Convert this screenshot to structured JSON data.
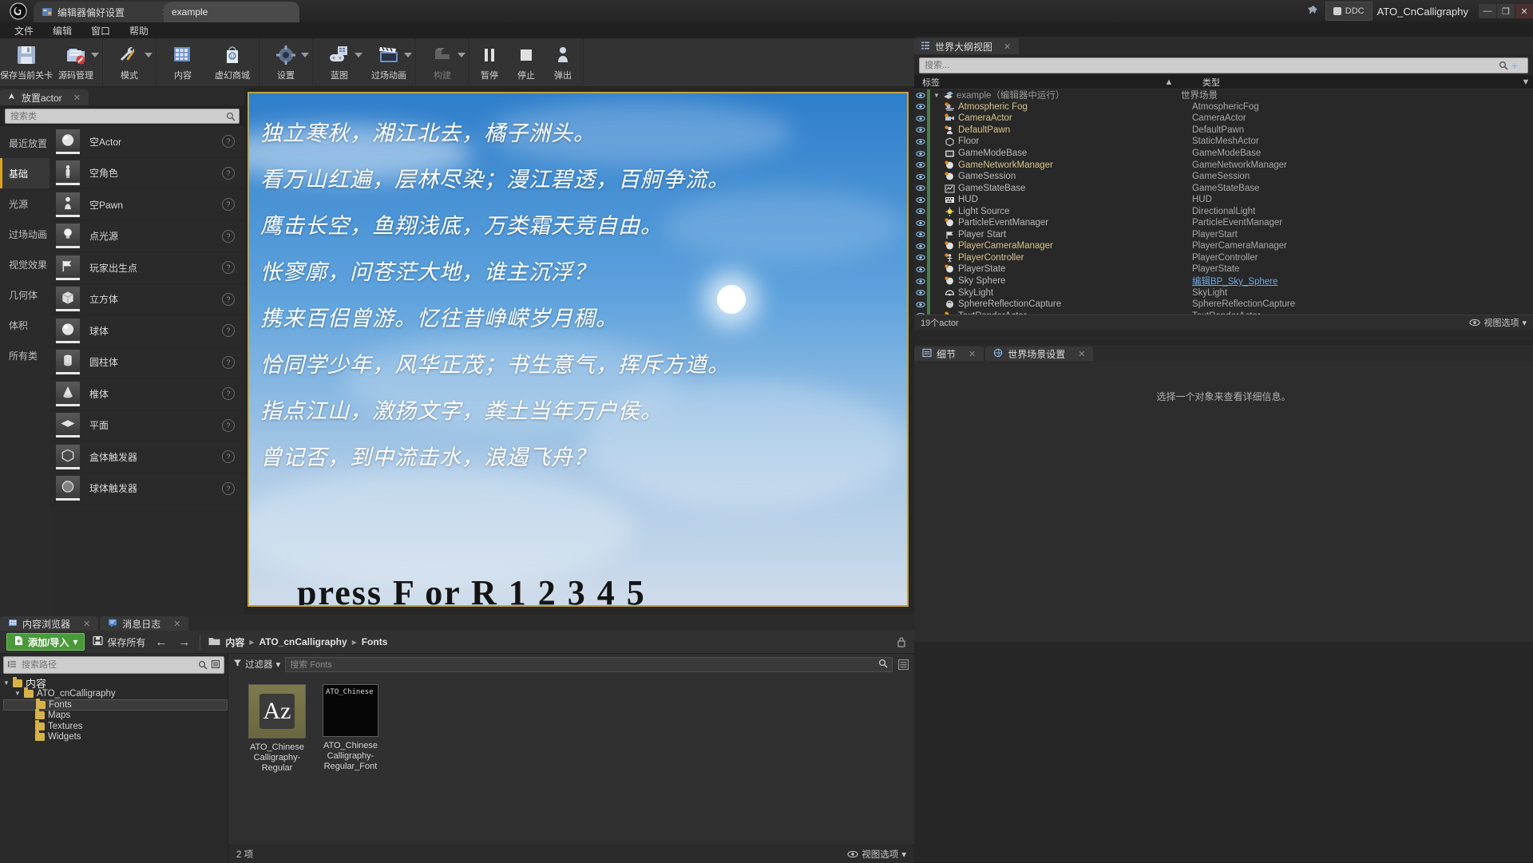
{
  "titlebar": {
    "logo_icon": "unreal-engine-logo",
    "tabs": [
      {
        "label": "编辑器偏好设置",
        "icon": "editor-prefs-icon",
        "active": false
      },
      {
        "label": "example",
        "icon": "",
        "active": true
      }
    ],
    "pin_icon": "pin-icon",
    "ddc_label": "DDC",
    "project_name": "ATO_CnCalligraphy",
    "minimize": "—",
    "maximize": "❐",
    "close": "✕"
  },
  "menubar": {
    "items": [
      "文件",
      "编辑",
      "窗口",
      "帮助"
    ]
  },
  "toolbar": {
    "groups": [
      {
        "buttons": [
          {
            "label": "保存当前关卡",
            "icon": "save-level-icon",
            "caret": false
          },
          {
            "label": "源码管理",
            "icon": "source-control-icon",
            "caret": true
          }
        ]
      },
      {
        "buttons": [
          {
            "label": "模式",
            "icon": "modes-wrench-icon",
            "caret": true
          }
        ]
      },
      {
        "buttons": [
          {
            "label": "内容",
            "icon": "content-grid-icon",
            "caret": false
          },
          {
            "label": "虚幻商城",
            "icon": "marketplace-bag-icon",
            "caret": false
          }
        ]
      },
      {
        "buttons": [
          {
            "label": "设置",
            "icon": "settings-gear-icon",
            "caret": true
          }
        ]
      },
      {
        "buttons": [
          {
            "label": "蓝图",
            "icon": "blueprint-gamepad-icon",
            "caret": true
          },
          {
            "label": "过场动画",
            "icon": "cinematics-clapper-icon",
            "caret": true
          }
        ]
      },
      {
        "buttons": [
          {
            "label": "构建",
            "icon": "build-icon",
            "caret": true,
            "disabled": true
          }
        ]
      },
      {
        "buttons": [
          {
            "label": "暂停",
            "icon": "pause-icon",
            "caret": false
          },
          {
            "label": "停止",
            "icon": "stop-icon",
            "caret": false
          },
          {
            "label": "弹出",
            "icon": "eject-icon",
            "caret": false
          }
        ]
      }
    ]
  },
  "place_panel": {
    "tab_label": "放置actor",
    "tab_icon": "place-actor-icon",
    "close_icon": "close-icon",
    "search_placeholder": "搜索类",
    "search_value": "",
    "search_icon": "search-icon",
    "categories": [
      {
        "label": "最近放置",
        "selected": false
      },
      {
        "label": "基础",
        "selected": true
      },
      {
        "label": "光源",
        "selected": false
      },
      {
        "label": "过场动画",
        "selected": false
      },
      {
        "label": "视觉效果",
        "selected": false
      },
      {
        "label": "几何体",
        "selected": false
      },
      {
        "label": "体积",
        "selected": false
      },
      {
        "label": "所有类",
        "selected": false
      }
    ],
    "items": [
      {
        "label": "空Actor",
        "icon": "sphere-thumb"
      },
      {
        "label": "空角色",
        "icon": "character-thumb"
      },
      {
        "label": "空Pawn",
        "icon": "pawn-thumb"
      },
      {
        "label": "点光源",
        "icon": "pointlight-thumb"
      },
      {
        "label": "玩家出生点",
        "icon": "playerstart-thumb"
      },
      {
        "label": "立方体",
        "icon": "cube-thumb"
      },
      {
        "label": "球体",
        "icon": "sphere-thumb"
      },
      {
        "label": "圆柱体",
        "icon": "cylinder-thumb"
      },
      {
        "label": "椎体",
        "icon": "cone-thumb"
      },
      {
        "label": "平面",
        "icon": "plane-thumb"
      },
      {
        "label": "盒体触发器",
        "icon": "boxtrigger-thumb"
      },
      {
        "label": "球体触发器",
        "icon": "spheretrigger-thumb"
      }
    ],
    "help_glyph": "?"
  },
  "viewport": {
    "border_color": "#c2a33a",
    "poem_lines": [
      "独立寒秋，湘江北去，橘子洲头。",
      "看万山红遍，层林尽染；漫江碧透，百舸争流。",
      "鹰击长空，鱼翔浅底，万类霜天竞自由。",
      "怅寥廓，问苍茫大地，谁主沉浮？",
      "携来百侣曾游。忆往昔峥嵘岁月稠。",
      "恰同学少年，风华正茂；书生意气，挥斥方遒。",
      "指点江山，激扬文字，粪土当年万户侯。",
      "曾记否，到中流击水，浪遏飞舟？"
    ],
    "bottom_text": "press F or R 1 2 3 4 5"
  },
  "outliner": {
    "tab_label": "世界大纲视图",
    "tab_icon": "outliner-icon",
    "close_icon": "close-icon",
    "search_placeholder": "搜索...",
    "search_value": "",
    "search_icon": "search-icon",
    "add_icon": "add-column-icon",
    "columns": {
      "label": "标签",
      "sort_glyph": "▲",
      "type": "类型",
      "type_menu": "▼"
    },
    "rows": [
      {
        "name": "example（编辑器中运行）",
        "type": "世界场景",
        "icon": "level-icon",
        "root": true,
        "name_color": "world"
      },
      {
        "name": "Atmospheric Fog",
        "type": "AtmosphericFog",
        "icon": "fog-icon"
      },
      {
        "name": "CameraActor",
        "type": "CameraActor",
        "icon": "camera-icon"
      },
      {
        "name": "DefaultPawn",
        "type": "DefaultPawn",
        "icon": "pawn-icon"
      },
      {
        "name": "Floor",
        "type": "StaticMeshActor",
        "icon": "mesh-icon",
        "name_color": "grey"
      },
      {
        "name": "GameModeBase",
        "type": "GameModeBase",
        "icon": "gamemode-icon",
        "name_color": "grey"
      },
      {
        "name": "GameNetworkManager",
        "type": "GameNetworkManager",
        "icon": "actor-icon"
      },
      {
        "name": "GameSession",
        "type": "GameSession",
        "icon": "actor-icon",
        "name_color": "grey"
      },
      {
        "name": "GameStateBase",
        "type": "GameStateBase",
        "icon": "gamestate-icon",
        "name_color": "grey"
      },
      {
        "name": "HUD",
        "type": "HUD",
        "icon": "hud-icon",
        "name_color": "grey"
      },
      {
        "name": "Light Source",
        "type": "DirectionalLight",
        "icon": "light-icon",
        "name_color": "grey"
      },
      {
        "name": "ParticleEventManager",
        "type": "ParticleEventManager",
        "icon": "actor-icon",
        "name_color": "grey"
      },
      {
        "name": "Player Start",
        "type": "PlayerStart",
        "icon": "playerstart-icon",
        "name_color": "grey"
      },
      {
        "name": "PlayerCameraManager",
        "type": "PlayerCameraManager",
        "icon": "actor-icon"
      },
      {
        "name": "PlayerController",
        "type": "PlayerController",
        "icon": "controller-icon"
      },
      {
        "name": "PlayerState",
        "type": "PlayerState",
        "icon": "actor-icon",
        "name_color": "grey"
      },
      {
        "name": "Sky Sphere",
        "type": "编辑BP_Sky_Sphere",
        "icon": "actor-icon",
        "name_color": "grey",
        "type_link": true
      },
      {
        "name": "SkyLight",
        "type": "SkyLight",
        "icon": "skylight-icon",
        "name_color": "grey"
      },
      {
        "name": "SphereReflectionCapture",
        "type": "SphereReflectionCapture",
        "icon": "reflection-icon",
        "name_color": "grey"
      },
      {
        "name": "TextRenderActor",
        "type": "TextRenderActor",
        "icon": "text-icon",
        "name_color": "grey"
      }
    ],
    "footer_count": "19个actor",
    "footer_options": "视图选项",
    "footer_eye_icon": "eye-icon",
    "footer_caret": "▾"
  },
  "details": {
    "tabs": [
      {
        "label": "细节",
        "icon": "details-icon",
        "active": true
      },
      {
        "label": "世界场景设置",
        "icon": "world-settings-icon",
        "active": false
      }
    ],
    "close_icon": "close-icon",
    "empty_message": "选择一个对象来查看详细信息。"
  },
  "content_browser": {
    "tabs": [
      {
        "label": "内容浏览器",
        "icon": "content-browser-icon",
        "active": true
      },
      {
        "label": "消息日志",
        "icon": "message-log-icon",
        "active": false
      }
    ],
    "close_icon": "close-icon",
    "add_button": "添加/导入",
    "add_icon": "add-file-icon",
    "add_caret": "▾",
    "save_all": "保存所有",
    "save_icon": "save-icon",
    "back_arrow": "←",
    "forward_arrow": "→",
    "folder_icon": "folder-icon",
    "breadcrumbs": [
      "内容",
      "ATO_cnCalligraphy",
      "Fonts"
    ],
    "breadcrumb_sep": "▸",
    "lock_icon": "lock-icon",
    "path_search_placeholder": "搜索路径",
    "path_search_value": "",
    "path_search_icon": "search-icon",
    "path_list_icon": "list-view-icon",
    "path_collapse_icon": "collapse-icon",
    "tree": [
      {
        "label": "内容",
        "depth": 0,
        "selected": false,
        "expanded": true
      },
      {
        "label": "ATO_cnCalligraphy",
        "depth": 1,
        "selected": false,
        "expanded": true
      },
      {
        "label": "Fonts",
        "depth": 2,
        "selected": true,
        "expanded": false
      },
      {
        "label": "Maps",
        "depth": 2,
        "selected": false,
        "expanded": false
      },
      {
        "label": "Textures",
        "depth": 2,
        "selected": false,
        "expanded": false
      },
      {
        "label": "Widgets",
        "depth": 2,
        "selected": false,
        "expanded": false
      }
    ],
    "filter_label": "过滤器",
    "filter_icon": "filter-icon",
    "filter_caret": "▾",
    "asset_search_placeholder": "搜索 Fonts",
    "asset_search_value": "",
    "view_options_icon": "view-grid-icon",
    "assets": [
      {
        "name": "ATO_Chinese Calligraphy-Regular",
        "thumb_text": "Az",
        "kind": "font"
      },
      {
        "name": "ATO_Chinese Calligraphy-Regular_Font",
        "thumb_text": "ATO_Chinese",
        "kind": "fontface"
      }
    ],
    "status_count": "2 项",
    "status_view_options": "视图选项",
    "status_eye_icon": "eye-icon",
    "status_caret": "▾"
  }
}
